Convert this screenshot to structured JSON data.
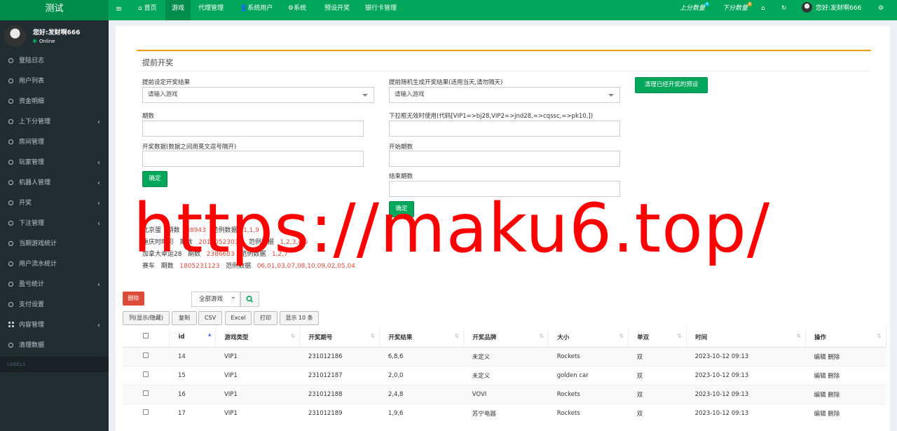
{
  "app": {
    "title": "测试"
  },
  "topnav": {
    "home": "首页",
    "items": [
      "游戏",
      "代理管理",
      "系统用户",
      "系统",
      "预设开奖",
      "银行卡管理"
    ],
    "right": {
      "shang_fen": "上分数量",
      "shang_fen_badge": "0",
      "xia_fen": "下分数量",
      "xia_fen_badge": "6",
      "user": "您好:发财啊666"
    }
  },
  "sidebar": {
    "user": "您好:发财啊666",
    "status": "Online",
    "items": [
      "登陆日志",
      "用户列表",
      "资金明细",
      "上下分管理",
      "房间管理",
      "玩家管理",
      "机器人管理",
      "开奖",
      "下注管理",
      "当期游戏统计",
      "用户流水统计",
      "盈亏统计",
      "支付设置",
      "内容管理",
      "清理数据"
    ],
    "labels": "LABELS"
  },
  "form": {
    "title": "提前开奖",
    "left": {
      "label1": "提前设定开奖结果",
      "select1_placeholder": "请输入游戏",
      "label2": "期数",
      "label3": "开奖数据(数据之间用英文逗号隔开)",
      "confirm": "确定"
    },
    "right": {
      "label1": "提前随机生成开奖结果(适用当天,请勿隔天)",
      "select1_placeholder": "请输入游戏",
      "label2": "下拉框无效时使用(代码[VIP1=>bj28,VIP2=>jnd28,=>cqssc,=>pk10,])",
      "label3": "开始期数",
      "label4": "结束期数",
      "confirm": "确定"
    },
    "clear_button": "清理已经开奖的预设",
    "info": [
      {
        "name": "北京蛋",
        "period_label": "期数",
        "period": "88943",
        "range_label": "范例数据",
        "range": "1,1,9"
      },
      {
        "name": "重庆时时彩",
        "period_label": "期数",
        "period": "20180523036",
        "range_label": "范例数据",
        "range": "1,2,3,4,5"
      },
      {
        "name": "加拿大幸运28",
        "period_label": "期数",
        "period": "2386603",
        "range_label": "范例数据",
        "range": "1,2,7"
      },
      {
        "name": "赛车",
        "period_label": "期数",
        "period": "1805231123",
        "range_label": "范例数据",
        "range": "06,01,03,07,08,10,09,02,05,04"
      }
    ]
  },
  "watermark": "https://maku6.top/",
  "table_tools": {
    "delete": "删除",
    "game_filter": "全部游戏",
    "buttons": [
      "列(显示/隐藏)",
      "复制",
      "CSV",
      "Excel",
      "打印",
      "显示 10 条"
    ]
  },
  "table": {
    "headers": [
      "id",
      "游戏类型",
      "开奖期号",
      "开奖结果",
      "开奖品牌",
      "大小",
      "单双",
      "时间",
      "操作"
    ],
    "rows": [
      {
        "id": "14",
        "game": "VIP1",
        "period": "231012186",
        "result": "6,8,6",
        "brand": "未定义",
        "size": "Rockets",
        "odd_even": "双",
        "time": "2023-10-12 09:13",
        "edit": "编辑",
        "del": "删除"
      },
      {
        "id": "15",
        "game": "VIP1",
        "period": "231012187",
        "result": "2,0,0",
        "brand": "未定义",
        "size": "golden car",
        "odd_even": "双",
        "time": "2023-10-12 09:13",
        "edit": "编辑",
        "del": "删除"
      },
      {
        "id": "16",
        "game": "VIP1",
        "period": "231012188",
        "result": "2,4,8",
        "brand": "VOVI",
        "size": "Rockets",
        "odd_even": "双",
        "time": "2023-10-12 09:13",
        "edit": "编辑",
        "del": "删除"
      },
      {
        "id": "17",
        "game": "VIP1",
        "period": "231012189",
        "result": "1,9,6",
        "brand": "苏宁电器",
        "size": "Rockets",
        "odd_even": "双",
        "time": "2023-10-12 09:13",
        "edit": "编辑",
        "del": "删除"
      }
    ]
  }
}
